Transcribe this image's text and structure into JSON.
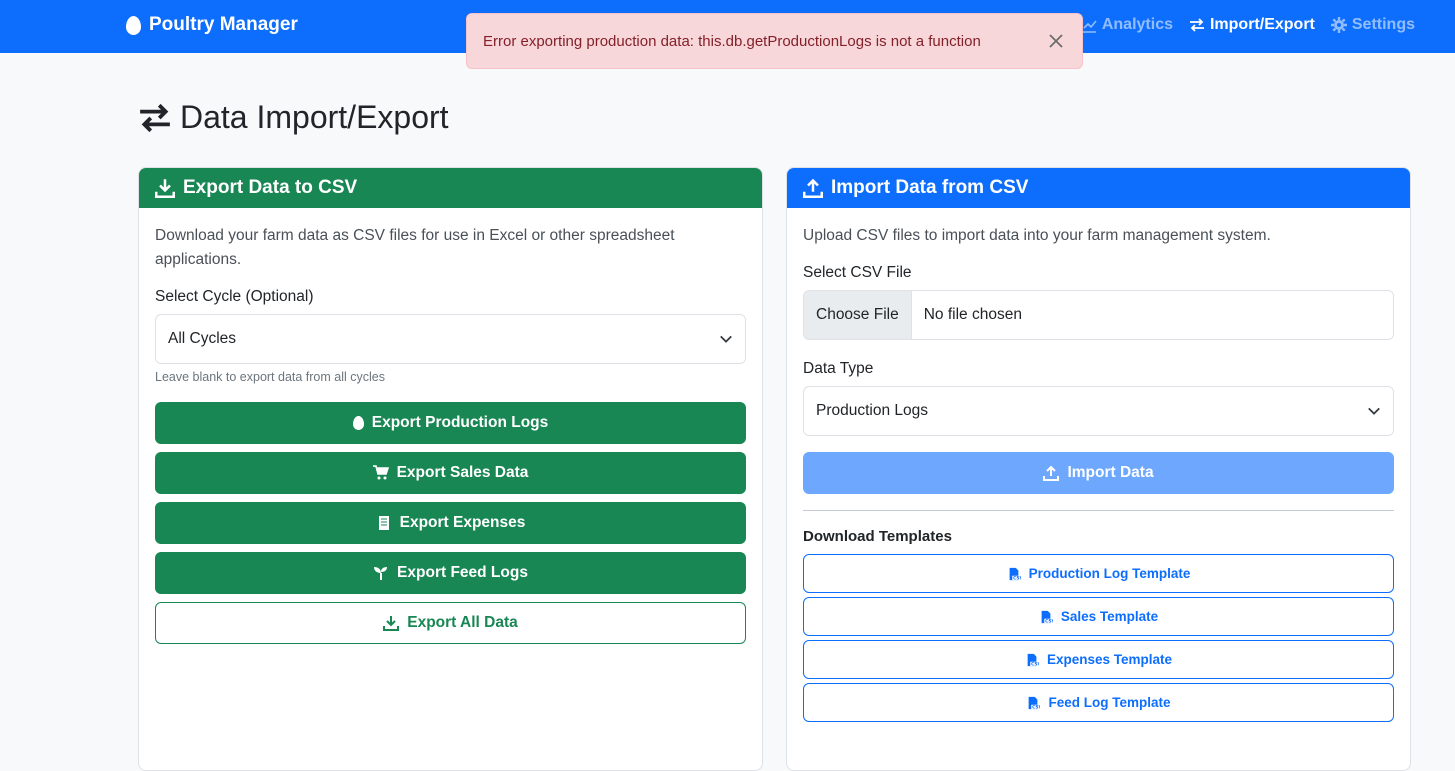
{
  "navbar": {
    "brand": "Poultry Manager",
    "links": [
      {
        "label": "Analytics",
        "icon": "chart-line-icon"
      },
      {
        "label": "Import/Export",
        "icon": "exchange-icon"
      },
      {
        "label": "Settings",
        "icon": "gear-icon"
      }
    ]
  },
  "toast": {
    "message": "Error exporting production data: this.db.getProductionLogs is not a function"
  },
  "page": {
    "title": "Data Import/Export"
  },
  "export_card": {
    "header": "Export Data to CSV",
    "description": "Download your farm data as CSV files for use in Excel or other spreadsheet applications.",
    "cycle_label": "Select Cycle (Optional)",
    "cycle_selected": "All Cycles",
    "cycle_help": "Leave blank to export data from all cycles",
    "buttons": {
      "production": "Export Production Logs",
      "sales": "Export Sales Data",
      "expenses": "Export Expenses",
      "feed": "Export Feed Logs",
      "all": "Export All Data"
    }
  },
  "import_card": {
    "header": "Import Data from CSV",
    "description": "Upload CSV files to import data into your farm management system.",
    "file_label": "Select CSV File",
    "file_button": "Choose File",
    "file_status": "No file chosen",
    "type_label": "Data Type",
    "type_selected": "Production Logs",
    "import_button": "Import Data",
    "templates_title": "Download Templates",
    "templates": {
      "production": "Production Log Template",
      "sales": "Sales Template",
      "expenses": "Expenses Template",
      "feed": "Feed Log Template"
    }
  },
  "colors": {
    "primary": "#0d6efd",
    "success": "#198754",
    "danger_bg": "#f8d7da",
    "danger_text": "#842029"
  }
}
